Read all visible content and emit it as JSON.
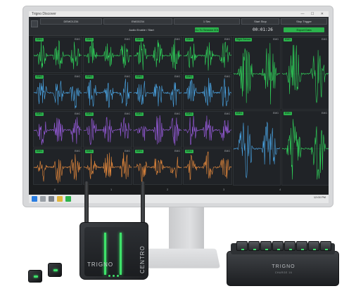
{
  "app": {
    "window_title": "Trigno Discover",
    "window_controls": "— ☐ ✕",
    "header": {
      "cells": [
        "DEMO1234",
        "EMG0234",
        "1 Sec",
        "Start Stop",
        "Stop Trigger"
      ],
      "sub_labels": [
        "",
        "Audio Enable / Start Sync",
        "",
        "",
        ""
      ],
      "buttons": [
        "Go To Session 001",
        "Export Data"
      ],
      "timer": "00:01:26"
    },
    "panel_tag": "EMG",
    "panel_label": "EMG",
    "wide_tag": "Right Sensor",
    "axis_ticks": [
      "0",
      "1",
      "2",
      "3",
      "4",
      "5"
    ],
    "taskbar_time": "12:00 PM"
  },
  "hardware": {
    "base_station_brand": "TRIGNO",
    "base_station_name": "CENTRO",
    "charger_brand": "TRIGNO",
    "charger_label": "CHARGE 16"
  },
  "colors": {
    "green": "#2fd45a",
    "blue": "#4aa6e6",
    "purple": "#9a5ce0",
    "orange": "#e88a3c",
    "accent": "#2bb24c"
  }
}
